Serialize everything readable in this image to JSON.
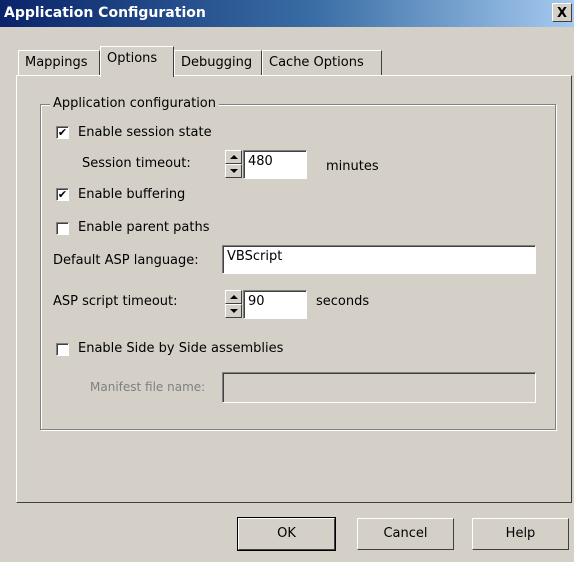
{
  "window": {
    "title": "Application Configuration",
    "close_glyph": "X"
  },
  "tabs": [
    {
      "label": "Mappings",
      "active": false
    },
    {
      "label": "Options",
      "active": true
    },
    {
      "label": "Debugging",
      "active": false
    },
    {
      "label": "Cache Options",
      "active": false
    }
  ],
  "group": {
    "title": "Application configuration",
    "enable_session_state": {
      "label": "Enable session state",
      "checked": true
    },
    "session_timeout": {
      "label": "Session timeout:",
      "value": "480",
      "unit": "minutes"
    },
    "enable_buffering": {
      "label": "Enable buffering",
      "checked": true
    },
    "enable_parent_paths": {
      "label": "Enable parent paths",
      "checked": false
    },
    "default_asp_language": {
      "label": "Default ASP language:",
      "value": "VBScript"
    },
    "asp_script_timeout": {
      "label": "ASP script timeout:",
      "value": "90",
      "unit": "seconds"
    },
    "side_by_side": {
      "label": "Enable Side by Side assemblies",
      "checked": false
    },
    "manifest_file": {
      "label": "Manifest file name:",
      "value": ""
    }
  },
  "buttons": {
    "ok": "OK",
    "cancel": "Cancel",
    "help": "Help"
  },
  "check_glyph": "✔"
}
